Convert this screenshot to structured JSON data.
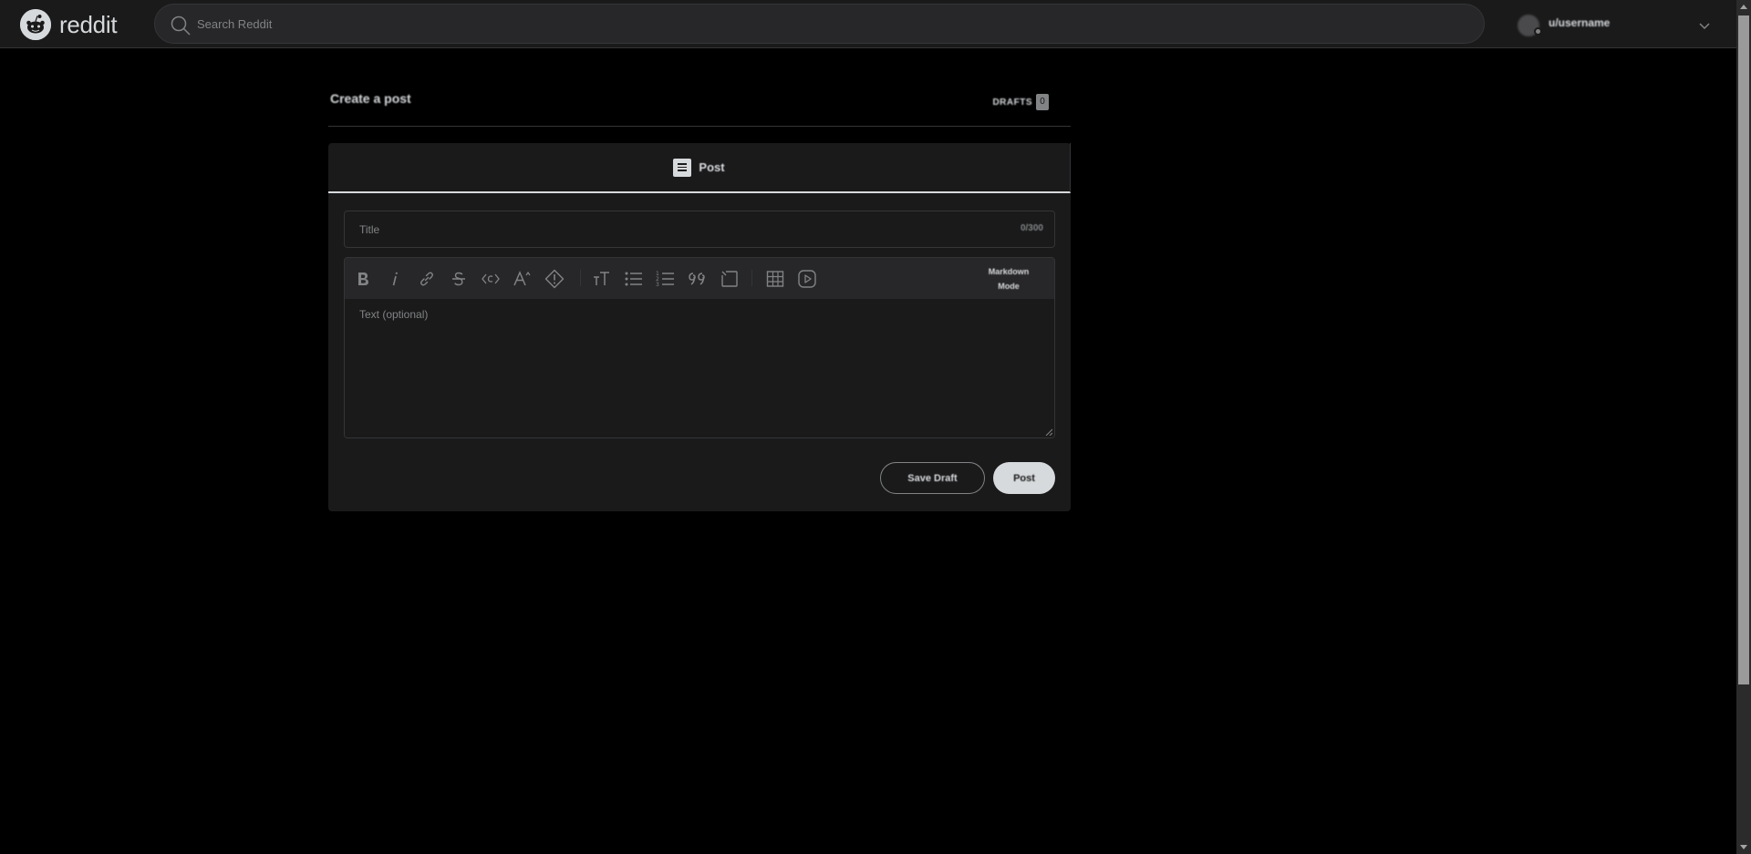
{
  "app": {
    "brand": "reddit"
  },
  "header": {
    "search_placeholder": "Search Reddit",
    "username": "u/username"
  },
  "page": {
    "title": "Create a post",
    "drafts_label": "DRAFTS",
    "drafts_count": "0"
  },
  "composer": {
    "tab_label": "Post",
    "title_placeholder": "Title",
    "title_counter": "0/300",
    "body_placeholder": "Text (optional)",
    "markdown_toggle_line1": "Markdown",
    "markdown_toggle_line2": "Mode",
    "toolbar_icons": [
      "bold-icon",
      "italic-icon",
      "link-icon",
      "strikethrough-icon",
      "inline-code-icon",
      "superscript-icon",
      "spoiler-icon",
      "heading-icon",
      "bulleted-list-icon",
      "numbered-list-icon",
      "quote-block-icon",
      "code-block-icon",
      "table-icon",
      "video-icon"
    ],
    "save_draft_label": "Save Draft",
    "post_label": "Post"
  },
  "colors": {
    "page_bg": "#000000",
    "surface": "#1a1a1b",
    "toolbar_bg": "#272729",
    "border": "#343536",
    "text": "#d7dadc",
    "muted": "#818384"
  }
}
